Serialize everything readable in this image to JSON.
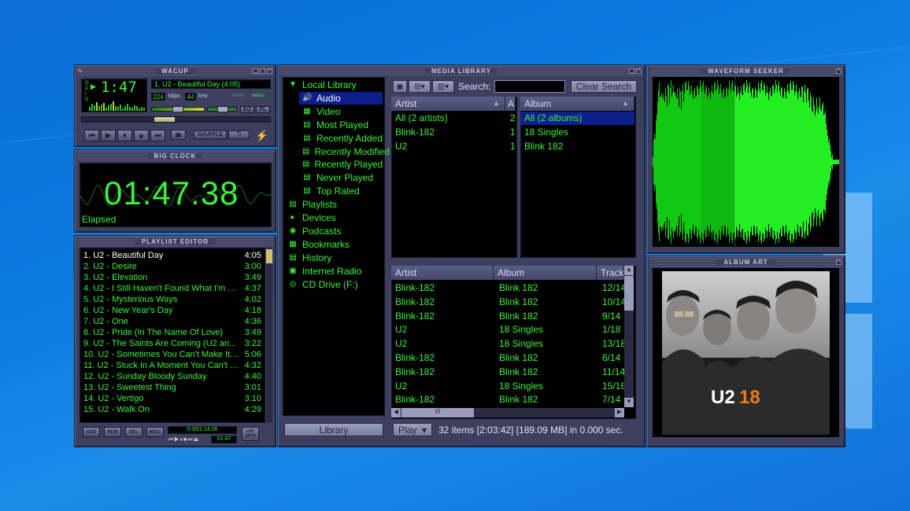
{
  "winamp": {
    "title": "WACUP",
    "time": "1:47",
    "track_title": "1. U2 - Beautiful Day (4:05)",
    "kbps": "224",
    "kbps_label": "kbps",
    "khz": "44",
    "khz_label": "kHz",
    "mono_label": "mono",
    "stereo_label": "stereo",
    "eq_label": "EQ",
    "pl_label": "PL",
    "shuffle_label": "SHUFFLE",
    "repeat_label": "⮌"
  },
  "big_clock": {
    "title": "BIG CLOCK",
    "time": "01:47.38",
    "mode": "Elapsed"
  },
  "playlist": {
    "title": "PLAYLIST EDITOR",
    "items": [
      {
        "title": "1. U2 - Beautiful Day",
        "duration": "4:05"
      },
      {
        "title": "2. U2 - Desire",
        "duration": "3:00"
      },
      {
        "title": "3. U2 - Elevation",
        "duration": "3:49"
      },
      {
        "title": "4. U2 - I Still Haven't Found What I'm L...",
        "duration": "4:37"
      },
      {
        "title": "5. U2 - Mysterious Ways",
        "duration": "4:02"
      },
      {
        "title": "6. U2 - New Year's Day",
        "duration": "4:18"
      },
      {
        "title": "7. U2 - One",
        "duration": "4:36"
      },
      {
        "title": "8. U2 - Pride (In The Name Of Love)",
        "duration": "3:49"
      },
      {
        "title": "9. U2 - The Saints Are Coming (U2 an...",
        "duration": "3:22"
      },
      {
        "title": "10. U2 - Sometimes You Can't Make It ...",
        "duration": "5:06"
      },
      {
        "title": "11. U2 - Stuck In A Moment You Can't G...",
        "duration": "4:32"
      },
      {
        "title": "12. U2 - Sunday Bloody Sunday",
        "duration": "4:40"
      },
      {
        "title": "13. U2 - Sweetest Thing",
        "duration": "3:01"
      },
      {
        "title": "14. U2 - Vertigo",
        "duration": "3:10"
      },
      {
        "title": "15. U2 - Walk On",
        "duration": "4:29"
      }
    ],
    "add_label": "ADD",
    "rem_label": "REM",
    "sel_label": "SEL",
    "misc_label": "MISC",
    "total_time": "0:00/1:14:26",
    "mini_time": "01:47",
    "list_label": "LIST OPTS"
  },
  "library": {
    "title": "MEDIA LIBRARY",
    "tree": [
      {
        "label": "Local Library",
        "icon": "triangle-down-icon"
      },
      {
        "label": "Audio",
        "icon": "speaker-icon"
      },
      {
        "label": "Video",
        "icon": "film-icon"
      },
      {
        "label": "Most Played",
        "icon": "doc-icon"
      },
      {
        "label": "Recently Added",
        "icon": "doc-icon"
      },
      {
        "label": "Recently Modified",
        "icon": "doc-icon"
      },
      {
        "label": "Recently Played",
        "icon": "doc-icon"
      },
      {
        "label": "Never Played",
        "icon": "doc-icon"
      },
      {
        "label": "Top Rated",
        "icon": "doc-icon"
      },
      {
        "label": "Playlists",
        "icon": "playlist-icon"
      },
      {
        "label": "Devices",
        "icon": "device-icon"
      },
      {
        "label": "Podcasts",
        "icon": "rss-icon"
      },
      {
        "label": "Bookmarks",
        "icon": "bookmark-icon"
      },
      {
        "label": "History",
        "icon": "history-icon"
      },
      {
        "label": "Internet Radio",
        "icon": "radio-icon"
      },
      {
        "label": "CD Drive (F:)",
        "icon": "cd-icon"
      }
    ],
    "library_button": "Library",
    "search_label": "Search:",
    "search_value": "",
    "clear_search": "Clear Search",
    "artist_header": "Artist",
    "artist_count_header": "A",
    "artists": [
      {
        "name": "All (2 artists)",
        "count": "2"
      },
      {
        "name": "Blink-182",
        "count": "1"
      },
      {
        "name": "U2",
        "count": "1"
      }
    ],
    "album_header": "Album",
    "albums": [
      "All (2 albums)",
      "18 Singles",
      "Blink 182"
    ],
    "tracks_headers": {
      "artist": "Artist",
      "album": "Album",
      "track": "Track"
    },
    "tracks": [
      {
        "artist": "Blink-182",
        "album": "Blink 182",
        "track": "12/14"
      },
      {
        "artist": "Blink-182",
        "album": "Blink 182",
        "track": "10/14"
      },
      {
        "artist": "Blink-182",
        "album": "Blink 182",
        "track": "9/14"
      },
      {
        "artist": "U2",
        "album": "18 Singles",
        "track": "1/18"
      },
      {
        "artist": "U2",
        "album": "18 Singles",
        "track": "13/18"
      },
      {
        "artist": "Blink-182",
        "album": "Blink 182",
        "track": "6/14"
      },
      {
        "artist": "Blink-182",
        "album": "Blink 182",
        "track": "11/14"
      },
      {
        "artist": "U2",
        "album": "18 Singles",
        "track": "15/18"
      },
      {
        "artist": "Blink-182",
        "album": "Blink 182",
        "track": "7/14"
      }
    ],
    "play_button": "Play",
    "status": "32 items [2:03:42] [189.09 MB] in 0.000 sec."
  },
  "waveform": {
    "title": "WAVEFORM SEEKER",
    "progress": 0.44
  },
  "album_art": {
    "title": "ALBUM ART",
    "logo_part1": "U2",
    "logo_part2": "18"
  },
  "colors": {
    "green": "#3cf23c",
    "panel": "#3c3f5e",
    "selection": "#0d1f8a",
    "accent_orange": "#f07a1a"
  }
}
